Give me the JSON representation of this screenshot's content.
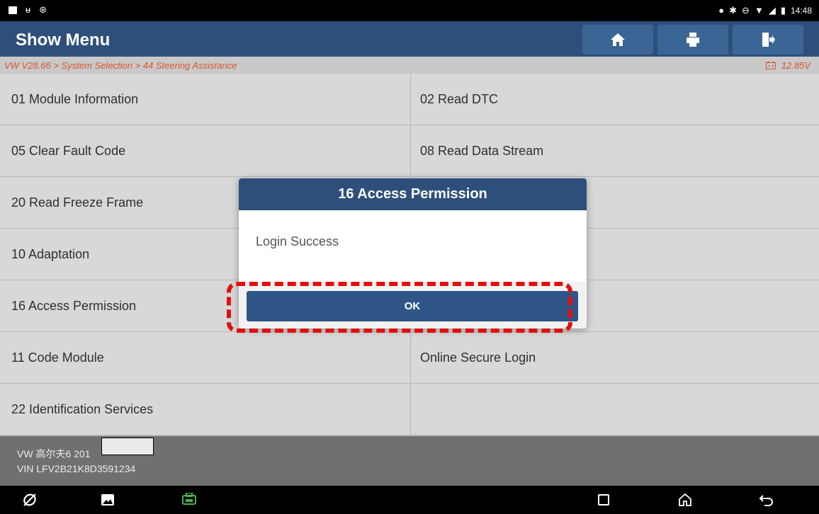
{
  "status_bar": {
    "time": "14:48",
    "left_icons": [
      "image-icon",
      "usb-icon",
      "vci-icon"
    ],
    "right_icons": [
      "location-icon",
      "bluetooth-icon",
      "dnd-icon",
      "wifi-icon",
      "signal-icon",
      "battery-icon"
    ]
  },
  "header": {
    "title": "Show Menu",
    "buttons": [
      "home-icon",
      "print-icon",
      "exit-icon"
    ]
  },
  "breadcrumb": {
    "path": "VW V28.66 > System Selection > 44 Steering Assistance",
    "voltage": "12.85V"
  },
  "menu": {
    "items": [
      {
        "left": "01 Module Information",
        "right": "02 Read DTC"
      },
      {
        "left": "05 Clear Fault Code",
        "right": "08 Read Data Stream"
      },
      {
        "left": "20 Read Freeze Frame",
        "right": ""
      },
      {
        "left": "10 Adaptation",
        "right": ""
      },
      {
        "left": "16 Access Permission",
        "right": ""
      },
      {
        "left": "11 Code Module",
        "right": "Online Secure Login"
      },
      {
        "left": "22 Identification Services",
        "right": ""
      }
    ]
  },
  "vehicle": {
    "model": "VW 高尔夫6 201",
    "vin": "VIN LFV2B21K8D3591234"
  },
  "dialog": {
    "title": "16 Access Permission",
    "message": "Login Success",
    "ok_label": "OK"
  },
  "colors": {
    "header_bg": "#2e4f7b",
    "accent_orange": "#d9542b",
    "highlight_red": "#e01010",
    "vci_green": "#4caf50"
  }
}
